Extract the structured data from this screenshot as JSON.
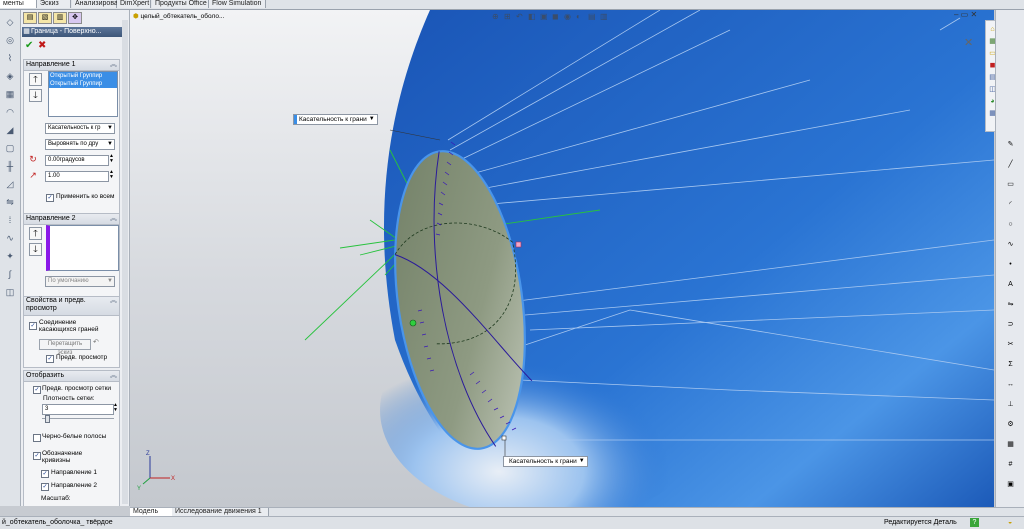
{
  "tabs": [
    {
      "label": "менты",
      "active": true
    },
    {
      "label": "Эскиз"
    },
    {
      "label": "Анализировать"
    },
    {
      "label": "DimXpert"
    },
    {
      "label": "Продукты Office"
    },
    {
      "label": "Flow Simulation"
    }
  ],
  "property_manager": {
    "title": "Граница - Поверхно...",
    "direction1": {
      "header": "Направление 1",
      "items": [
        "Открытый Группир",
        "Открытый Группир"
      ],
      "tangency": "Касательность к гр",
      "align": "Выровнять по дру",
      "angle": "0.00градусов",
      "length": "1.00",
      "apply_all": "Применить ко всем"
    },
    "direction2": {
      "header": "Направление 2",
      "default": "По умолчанию"
    },
    "props": {
      "header": "Свойства и предв. просмотр",
      "merge": "Соединение касающихся граней",
      "drag_sketch": "Перетащить эскиз",
      "preview": "Предв. просмотр"
    },
    "display": {
      "header": "Отобразить",
      "mesh_preview": "Предв. просмотр сетки",
      "mesh_density_label": "Плотность сетки:",
      "mesh_density": "3",
      "zebra": "Черно-белые полосы",
      "curvature": "Обозначение кривизны",
      "dir1": "Направление 1",
      "dir2": "Направление 2",
      "scale": "Масштаб:"
    }
  },
  "tree": {
    "item": "целый_обтекатель_оболо..."
  },
  "callouts": {
    "top": "Касательность к грани",
    "bottom": "Касательность к грани"
  },
  "bottom_tabs": [
    {
      "label": "Модель",
      "active": true
    },
    {
      "label": "Исследование движения 1"
    }
  ],
  "status": {
    "left": "й_обтекатель_оболочка_ твёрдое",
    "right": "Редактируется Деталь"
  },
  "triad": {
    "x": "X",
    "y": "Y",
    "z": "Z"
  },
  "colors": {
    "surface": "#1d5fbf",
    "accent": "#3a8ee6",
    "preview_green": "#7f8f6e",
    "mesh": "#2a1a9a"
  }
}
